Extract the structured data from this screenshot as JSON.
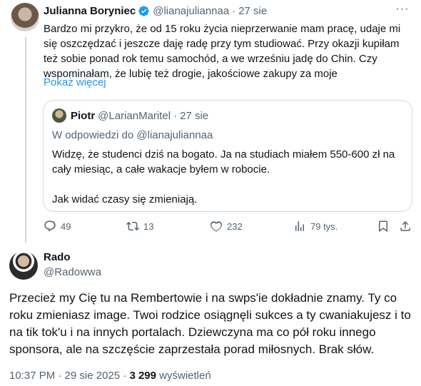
{
  "tweet1": {
    "author_name": "Julianna Boryniec",
    "handle": "@lianajuliannaa",
    "separator": "·",
    "time": "27 sie",
    "body": "Bardzo mi przykro, że od 15 roku życia nieprzerwanie mam pracę, udaje mi się oszczędzać i jeszcze daję radę przy tym studiować. Przy okazji kupiłam też sobie ponad rok temu samochód, a we wrześniu jadę do Chin. Czy wspominałam, że lubię też drogie, jakościowe zakupy za moje",
    "show_more": "Pokaż więcej",
    "more_menu": "···",
    "quote": {
      "author_name": "Piotr",
      "handle": "@LarianMaritel",
      "separator": "·",
      "time": "27 sie",
      "reply_to": "W odpowiedzi do @lianajuliannaa",
      "paragraph1": "Widzę, że studenci dziś na bogato. Ja na studiach miałem 550-600 zł na cały miesiąc, a całe wakacje byłem w robocie.",
      "paragraph2": "Jak widać czasy się zmieniają."
    },
    "actions": {
      "replies": "49",
      "retweets": "13",
      "likes": "232",
      "views": "79 tys."
    }
  },
  "tweet2": {
    "author_name": "Rado",
    "handle": "@Radowwa",
    "body": "Przecież my Cię tu na Rembertowie i na swps'ie dokładnie znamy. Ty co roku zmieniasz image. Twoi rodzice osiągnęli sukces a ty cwaniakujesz i to na tik tok'u i na innych portalach. Dziewczyna ma co pół roku innego sponsora, ale na szczęście zaprzestała porad miłosnych. Brak słów.",
    "timestamp": "10:37 PM · 29 sie 2025 ·",
    "views_count": "3 299",
    "views_label": "wyświetleń"
  },
  "colors": {
    "text": "#0f1419",
    "secondary": "#536471",
    "link": "#1d9bf0",
    "border": "#cfd9de",
    "verified": "#1d9bf0"
  },
  "icons": [
    "verified-badge-icon",
    "more-icon",
    "reply-icon",
    "retweet-icon",
    "like-icon",
    "views-icon",
    "bookmark-icon",
    "share-icon"
  ]
}
